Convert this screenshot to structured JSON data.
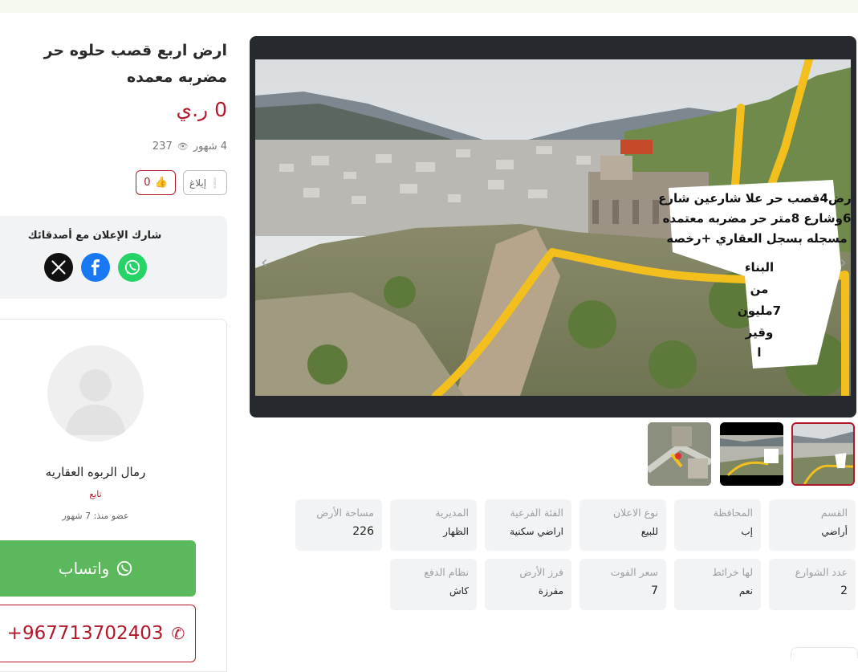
{
  "listing": {
    "title": "ارض اربع قصب حلوه حر مضربه معمده",
    "price": "0 ر.ي",
    "age": "4 شهور",
    "views": "237",
    "report_label": "إبلاغ",
    "likes": "0"
  },
  "share": {
    "title": "شارك الإعلان مع أصدقائك",
    "networks": [
      "x-icon",
      "facebook-icon",
      "whatsapp-icon"
    ]
  },
  "seller": {
    "name": "رمال الربوه العقاريه",
    "follow_label": "تابع",
    "member_since": "عضو منذ: 7 شهور",
    "whatsapp_label": "واتساب",
    "phone": "+967713702403"
  },
  "image_overlay": {
    "lines": [
      "ارض4قصب حر علا شارعين شارع",
      "6وشارع 8متر حر مضربه معتمده",
      "مسجله بسجل العقاري +رخصه",
      "البناء",
      "من",
      "7مليون",
      "وقير",
      "ا"
    ]
  },
  "details": [
    {
      "label": "القسم",
      "value": "أراضي"
    },
    {
      "label": "المحافظة",
      "value": "إب"
    },
    {
      "label": "نوع الاعلان",
      "value": "للبيع"
    },
    {
      "label": "الفئة الفرعية",
      "value": "اراضي سكنية"
    },
    {
      "label": "المديرية",
      "value": "الظهار"
    },
    {
      "label": "مساحة الأرض",
      "value": "226"
    },
    {
      "label": "عدد الشوارع",
      "value": "2"
    },
    {
      "label": "لها خرائط",
      "value": "نعم"
    },
    {
      "label": "سعر الفوت",
      "value": "7"
    },
    {
      "label": "فرز الأرض",
      "value": "مفرزة"
    },
    {
      "label": "نظام الدفع",
      "value": "كاش"
    }
  ],
  "colors": {
    "accent": "#b3182a",
    "whatsapp": "#5cb85c",
    "facebook": "#1877f2",
    "panel": "#f2f3f4",
    "gallery_bg": "#26292d"
  }
}
